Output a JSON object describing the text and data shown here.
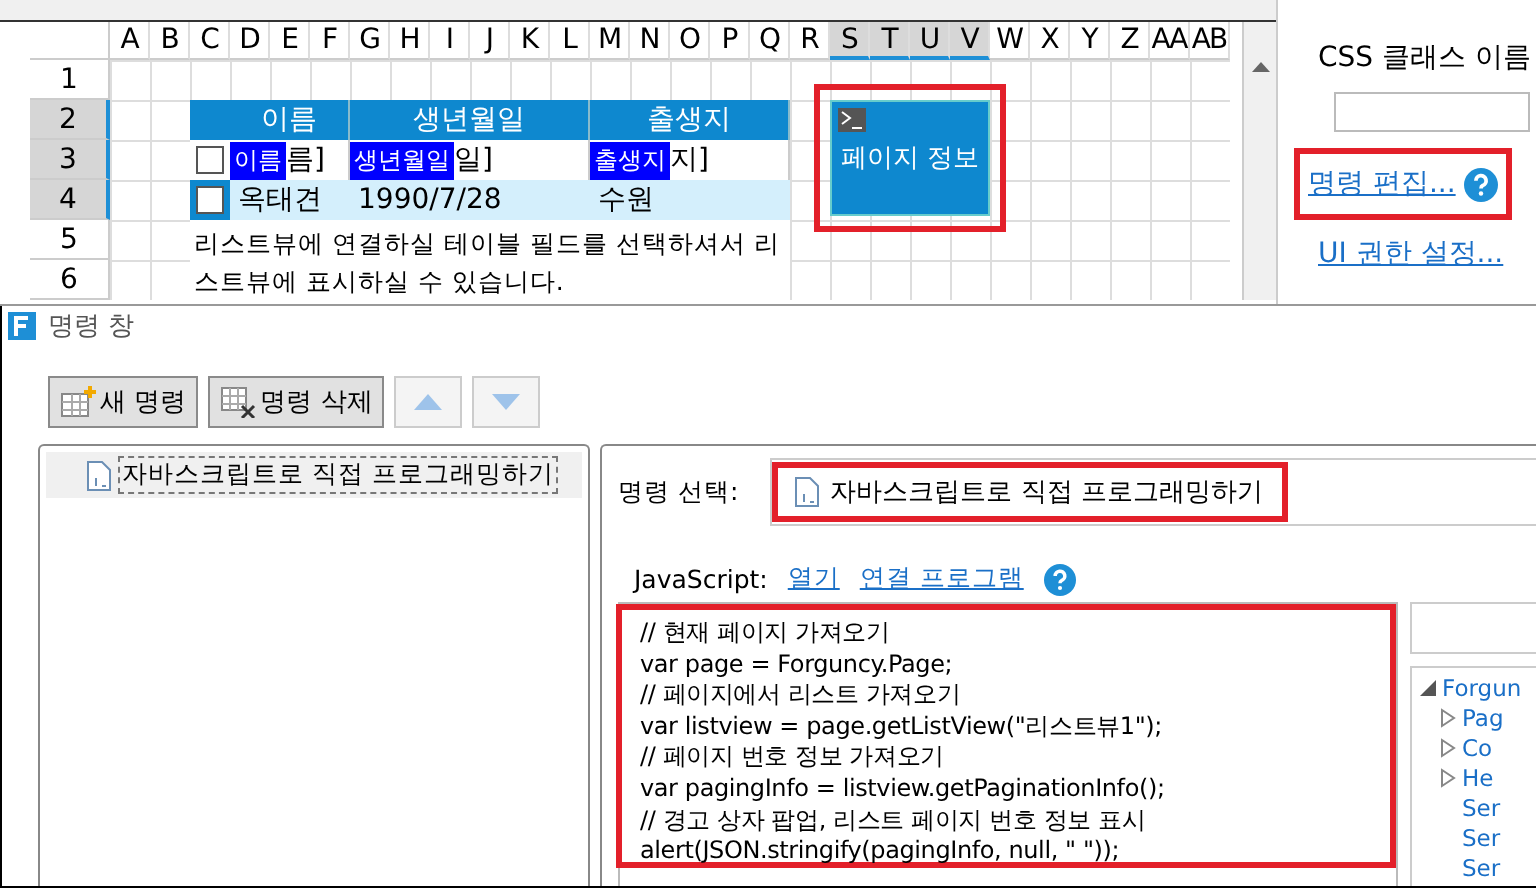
{
  "sheet": {
    "columns": [
      {
        "label": "A",
        "selected": false
      },
      {
        "label": "B",
        "selected": false
      },
      {
        "label": "C",
        "selected": false
      },
      {
        "label": "D",
        "selected": false
      },
      {
        "label": "E",
        "selected": false
      },
      {
        "label": "F",
        "selected": false
      },
      {
        "label": "G",
        "selected": false
      },
      {
        "label": "H",
        "selected": false
      },
      {
        "label": "I",
        "selected": false
      },
      {
        "label": "J",
        "selected": false
      },
      {
        "label": "K",
        "selected": false
      },
      {
        "label": "L",
        "selected": false
      },
      {
        "label": "M",
        "selected": false
      },
      {
        "label": "N",
        "selected": false
      },
      {
        "label": "O",
        "selected": false
      },
      {
        "label": "P",
        "selected": false
      },
      {
        "label": "Q",
        "selected": false
      },
      {
        "label": "R",
        "selected": false
      },
      {
        "label": "S",
        "selected": true
      },
      {
        "label": "T",
        "selected": true
      },
      {
        "label": "U",
        "selected": true
      },
      {
        "label": "V",
        "selected": true
      },
      {
        "label": "W",
        "selected": false
      },
      {
        "label": "X",
        "selected": false
      },
      {
        "label": "Y",
        "selected": false
      },
      {
        "label": "Z",
        "selected": false
      },
      {
        "label": "AA",
        "selected": false
      },
      {
        "label": "AB",
        "selected": false
      }
    ],
    "rows": [
      {
        "label": "1",
        "selected": false
      },
      {
        "label": "2",
        "selected": true
      },
      {
        "label": "3",
        "selected": true
      },
      {
        "label": "4",
        "selected": true
      },
      {
        "label": "5",
        "selected": false
      },
      {
        "label": "6",
        "selected": false
      }
    ],
    "listview": {
      "headers": [
        "이름",
        "생년월일",
        "출생지"
      ],
      "template_checked": false,
      "bindings": [
        {
          "badge": "이름",
          "text": "름]"
        },
        {
          "badge": "생년월일",
          "text": "일]"
        },
        {
          "badge": "출생지",
          "text": "지]"
        }
      ],
      "record": {
        "checked": false,
        "cells": [
          "옥태견",
          "1990/7/28",
          "수원"
        ]
      }
    },
    "note": "리스트뷰에 연결하실 테이블 필드를 선택하셔서 리스트뷰에 표시하실 수 있습니다.",
    "button": {
      "label": "페이지 정보"
    }
  },
  "properties": {
    "label": "CSS 클래스 이름",
    "links": [
      "명령 편집...",
      "UI 권한 설정..."
    ]
  },
  "dialog": {
    "title": "명령 창",
    "toolbar": [
      {
        "kind": "new",
        "label": "새 명령",
        "disabled": false
      },
      {
        "kind": "delete",
        "label": "명령 삭제",
        "disabled": false
      },
      {
        "kind": "up",
        "disabled": true
      },
      {
        "kind": "down",
        "disabled": true
      }
    ],
    "commands": [
      {
        "label": "자바스크립트로 직접 프로그래밍하기",
        "selected": true
      }
    ],
    "select_label": "명령 선택:",
    "selected_command": "자바스크립트로 직접 프로그래밍하기",
    "js_label": "JavaScript:",
    "js_links": [
      "열기",
      "연결 프로그램"
    ],
    "code": [
      "// 현재 페이지 가져오기",
      "var page = Forguncy.Page;",
      "// 페이지에서 리스트 가져오기",
      "var listview = page.getListView(\"리스트뷰1\");",
      "// 페이지 번호 정보 가져오기",
      "var pagingInfo = listview.getPaginationInfo();",
      "// 경고 상자 팝업, 리스트 페이지 번호 정보 표시",
      "alert(JSON.stringify(pagingInfo, null, \" \"));"
    ],
    "tree": [
      {
        "label": "Forgun",
        "expanded": true,
        "children": [
          {
            "label": "Pag",
            "expanded": false
          },
          {
            "label": "Co",
            "expanded": false
          },
          {
            "label": "He",
            "expanded": false
          },
          {
            "label": "Ser"
          },
          {
            "label": "Ser"
          },
          {
            "label": "Ser"
          }
        ]
      }
    ]
  }
}
